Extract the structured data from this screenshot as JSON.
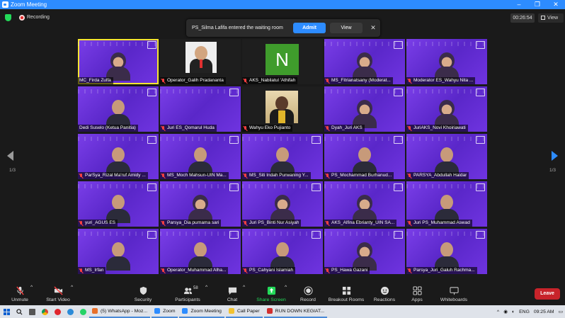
{
  "window": {
    "title": "Zoom Meeting",
    "controls": [
      "–",
      "❐",
      "✕"
    ]
  },
  "topbar": {
    "recording_label": "Recording",
    "timer": "00:26:54",
    "view_label": "View"
  },
  "notification": {
    "message": "PS_Silma Lafifa entered the waiting room",
    "admit_label": "Admit",
    "view_label": "View",
    "close_glyph": "✕"
  },
  "participants": [
    {
      "name": "MC_Firda Zulfa",
      "kind": "video",
      "look": "hijab",
      "active": true,
      "muted": false
    },
    {
      "name": "Operator_Galih Pradananta",
      "kind": "photo",
      "muted": true
    },
    {
      "name": "AKS_Nabilatul 'Athifah",
      "kind": "initial",
      "initial": "N",
      "muted": true
    },
    {
      "name": "MS_Fitrianatsany (Moderat...",
      "kind": "video",
      "look": "hijab",
      "muted": true
    },
    {
      "name": "Moderator ES_Wahyu Nita ...",
      "kind": "video",
      "look": "hijab",
      "muted": true
    },
    {
      "name": "Dedi Suselo (Ketua Panitia)",
      "kind": "video",
      "look": "person",
      "muted": false
    },
    {
      "name": "Juri ES_Qomarul Huda",
      "kind": "video",
      "look": "none",
      "muted": true
    },
    {
      "name": "Wahyu Eko Pujianto",
      "kind": "graduate",
      "muted": true
    },
    {
      "name": "Dyah_Juri AKS",
      "kind": "video",
      "look": "hijab",
      "muted": true
    },
    {
      "name": "JuriAKS_Novi Khoiriawati",
      "kind": "video",
      "look": "hijab",
      "muted": true
    },
    {
      "name": "ParSya_Rizal Ma'ruf Amidy ...",
      "kind": "video",
      "look": "person",
      "muted": true
    },
    {
      "name": "MS_Moch Mahsun-UIN Ma...",
      "kind": "video",
      "look": "person",
      "muted": true
    },
    {
      "name": "MS_Siti Indah Purwaning Y...",
      "kind": "video",
      "look": "person",
      "muted": true
    },
    {
      "name": "PS_Mochammad Burhanud...",
      "kind": "video",
      "look": "person",
      "muted": true
    },
    {
      "name": "PARSYA_Abdullah Haidar",
      "kind": "video",
      "look": "person",
      "muted": true
    },
    {
      "name": "yuri_AGUS ES",
      "kind": "video",
      "look": "person",
      "muted": true
    },
    {
      "name": "Parsya_Dia purnama sari",
      "kind": "video",
      "look": "hijab",
      "muted": true
    },
    {
      "name": "Juri PS_Binti Nur Asiyah",
      "kind": "video",
      "look": "hijab",
      "muted": true
    },
    {
      "name": "AKS_Alfina Ebrianty_UIN SA...",
      "kind": "video",
      "look": "hijab",
      "muted": true
    },
    {
      "name": "Juri PS_Muhammad Aswad",
      "kind": "video",
      "look": "person",
      "muted": true
    },
    {
      "name": "MS_Irfan",
      "kind": "video",
      "look": "person",
      "muted": true
    },
    {
      "name": "Operator_Muhammad Alha...",
      "kind": "video",
      "look": "person",
      "muted": true
    },
    {
      "name": "PS_Cahyani Islamiah",
      "kind": "video",
      "look": "person",
      "muted": true
    },
    {
      "name": "PS_Hawa Gazani",
      "kind": "video",
      "look": "hijab",
      "muted": true
    },
    {
      "name": "Parsya_Juri_Galuh Rachma...",
      "kind": "video",
      "look": "person",
      "muted": true
    }
  ],
  "pagination": {
    "left": "1/3",
    "right": "1/3"
  },
  "toolbar": {
    "unmute": "Unmute",
    "start_video": "Start Video",
    "security": "Security",
    "participants": "Participants",
    "participants_count": "58",
    "chat": "Chat",
    "share_screen": "Share Screen",
    "record": "Record",
    "breakout": "Breakout Rooms",
    "reactions": "Reactions",
    "apps": "Apps",
    "whiteboards": "Whiteboards",
    "leave": "Leave"
  },
  "taskbar": {
    "apps": [
      {
        "label": "(5) WhatsApp - Moz...",
        "color": "#e8702a"
      },
      {
        "label": "Zoom",
        "color": "#2d8cff"
      },
      {
        "label": "Zoom Meeting",
        "color": "#2d8cff"
      },
      {
        "label": "Call Paper",
        "color": "#f2c230"
      },
      {
        "label": "RUN DOWN KEGIAT...",
        "color": "#d12f2f"
      }
    ],
    "language": "ENG",
    "time": "09:25 AM"
  },
  "colors": {
    "accent": "#2d8cff",
    "leave": "#c8232a",
    "share": "#23d959",
    "tile_bg": "#6a35d6",
    "active_speaker": "#f5e531"
  }
}
